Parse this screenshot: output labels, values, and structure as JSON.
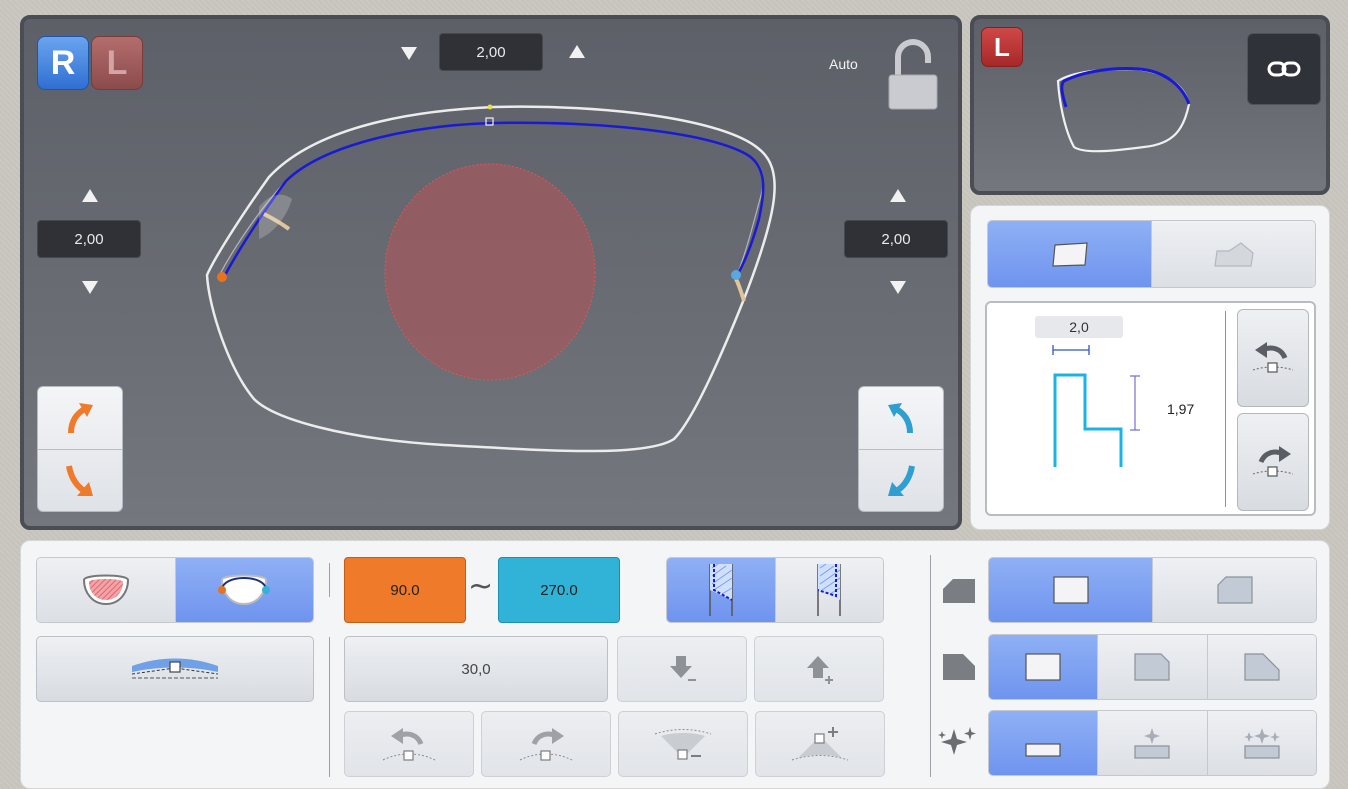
{
  "editor": {
    "badge_r": "R",
    "badge_l": "L",
    "top_value": "2,00",
    "left_value": "2,00",
    "right_value": "2,00",
    "auto_label": "Auto",
    "left_point_color": "#e8731f",
    "right_point_color": "#58a9e0",
    "bevel_color": "#1a1ad6"
  },
  "preview": {
    "badge": "L",
    "link_icon": "link-icon"
  },
  "groove": {
    "width_value": "2,0",
    "depth_value": "1,97",
    "groove_color": "#19b3e6"
  },
  "bottom": {
    "range_start": "90.0",
    "range_tilde": "~",
    "range_end": "270.0",
    "value_field": "30,0"
  },
  "colors": {
    "accent_blue": "#7a9cf0",
    "orange": "#ee7a2a",
    "cyan": "#31b3d8"
  }
}
